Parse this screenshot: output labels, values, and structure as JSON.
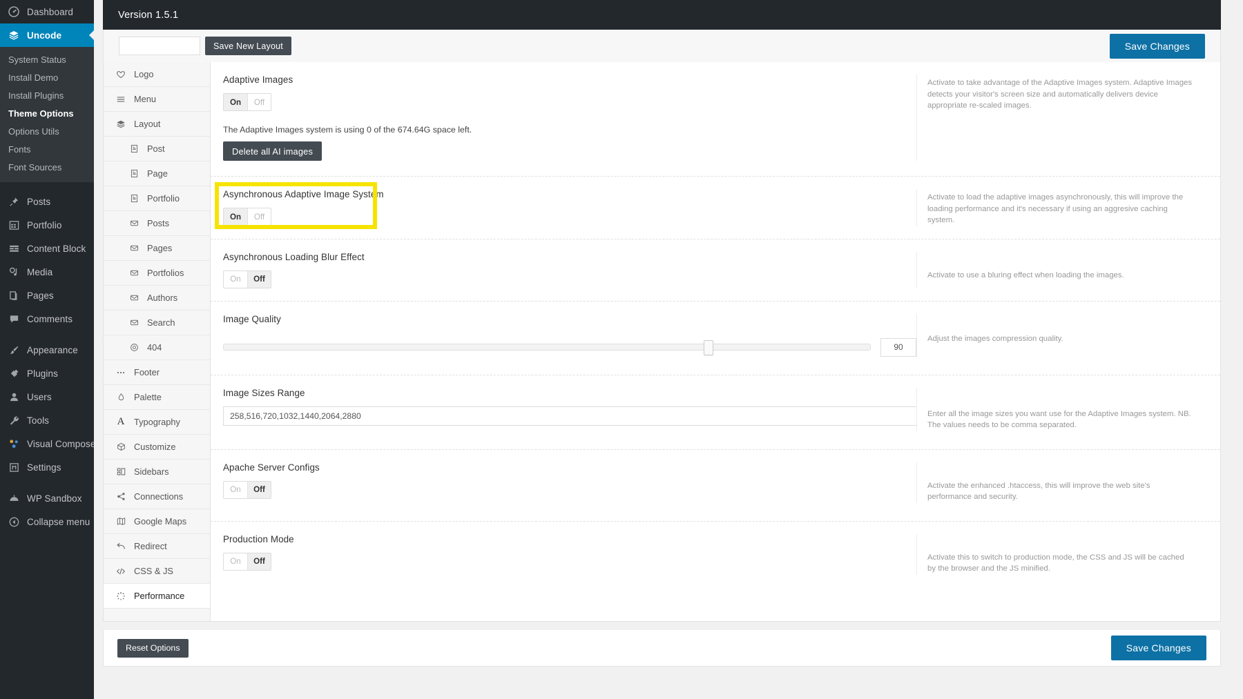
{
  "admin_menu": {
    "items": [
      {
        "label": "Dashboard",
        "icon": "dashboard-icon",
        "current": false
      },
      {
        "label": "Uncode",
        "icon": "layers-icon",
        "current": true
      }
    ],
    "submenu": [
      {
        "label": "System Status",
        "current": false
      },
      {
        "label": "Install Demo",
        "current": false
      },
      {
        "label": "Install Plugins",
        "current": false
      },
      {
        "label": "Theme Options",
        "current": true
      },
      {
        "label": "Options Utils",
        "current": false
      },
      {
        "label": "Fonts",
        "current": false
      },
      {
        "label": "Font Sources",
        "current": false
      }
    ],
    "group_two": [
      {
        "label": "Posts",
        "icon": "pin-icon"
      },
      {
        "label": "Portfolio",
        "icon": "grid-icon"
      },
      {
        "label": "Content Block",
        "icon": "blocks-icon"
      },
      {
        "label": "Media",
        "icon": "media-icon"
      },
      {
        "label": "Pages",
        "icon": "pages-icon"
      },
      {
        "label": "Comments",
        "icon": "comment-icon"
      }
    ],
    "group_three": [
      {
        "label": "Appearance",
        "icon": "brush-icon"
      },
      {
        "label": "Plugins",
        "icon": "plug-icon"
      },
      {
        "label": "Users",
        "icon": "user-icon"
      },
      {
        "label": "Tools",
        "icon": "wrench-icon"
      },
      {
        "label": "Visual Composer",
        "icon": "vc-icon"
      },
      {
        "label": "Settings",
        "icon": "settings-icon"
      }
    ],
    "group_four": [
      {
        "label": "WP Sandbox",
        "icon": "sandbox-icon"
      },
      {
        "label": "Collapse menu",
        "icon": "collapse-icon"
      }
    ]
  },
  "header": {
    "version": "Version 1.5.1",
    "layout_name_value": "",
    "layout_name_placeholder": "",
    "save_new_layout": "Save New Layout",
    "save_changes": "Save Changes"
  },
  "tabs": [
    {
      "label": "Logo",
      "icon": "heart-icon",
      "sub": false,
      "active": false
    },
    {
      "label": "Menu",
      "icon": "menu-icon",
      "sub": false,
      "active": false
    },
    {
      "label": "Layout",
      "icon": "layers-icon",
      "sub": false,
      "active": false
    },
    {
      "label": "Post",
      "icon": "document-icon",
      "sub": true,
      "active": false
    },
    {
      "label": "Page",
      "icon": "document-icon",
      "sub": true,
      "active": false
    },
    {
      "label": "Portfolio",
      "icon": "document-icon",
      "sub": true,
      "active": false
    },
    {
      "label": "Posts",
      "icon": "envelope-icon",
      "sub": true,
      "active": false
    },
    {
      "label": "Pages",
      "icon": "envelope-icon",
      "sub": true,
      "active": false
    },
    {
      "label": "Portfolios",
      "icon": "envelope-icon",
      "sub": true,
      "active": false
    },
    {
      "label": "Authors",
      "icon": "envelope-icon",
      "sub": true,
      "active": false
    },
    {
      "label": "Search",
      "icon": "envelope-icon",
      "sub": true,
      "active": false
    },
    {
      "label": "404",
      "icon": "target-icon",
      "sub": true,
      "active": false
    },
    {
      "label": "Footer",
      "icon": "dots-icon",
      "sub": false,
      "active": false
    },
    {
      "label": "Palette",
      "icon": "droplet-icon",
      "sub": false,
      "active": false
    },
    {
      "label": "Typography",
      "icon": "typography-icon",
      "sub": false,
      "active": false
    },
    {
      "label": "Customize",
      "icon": "cube-icon",
      "sub": false,
      "active": false
    },
    {
      "label": "Sidebars",
      "icon": "sidebars-icon",
      "sub": false,
      "active": false
    },
    {
      "label": "Connections",
      "icon": "share-icon",
      "sub": false,
      "active": false
    },
    {
      "label": "Google Maps",
      "icon": "map-icon",
      "sub": false,
      "active": false
    },
    {
      "label": "Redirect",
      "icon": "arrow-back-icon",
      "sub": false,
      "active": false
    },
    {
      "label": "CSS & JS",
      "icon": "code-icon",
      "sub": false,
      "active": false
    },
    {
      "label": "Performance",
      "icon": "spinner-icon",
      "sub": false,
      "active": true
    }
  ],
  "fields": {
    "adaptive_images": {
      "title": "Adaptive Images",
      "toggle_on": "On",
      "toggle_off": "Off",
      "selected": "On",
      "note": "The Adaptive Images system is using 0 of the 674.64G space left.",
      "delete_button": "Delete all AI images",
      "description": "Activate to take advantage of the Adaptive Images system. Adaptive Images detects your visitor's screen size and automatically delivers device appropriate re-scaled images."
    },
    "async_adaptive": {
      "title": "Asynchronous Adaptive Image System",
      "toggle_on": "On",
      "toggle_off": "Off",
      "selected": "On",
      "description": "Activate to load the adaptive images asynchronously, this will improve the loading performance and it's necessary if using an aggresive caching system."
    },
    "blur_effect": {
      "title": "Asynchronous Loading Blur Effect",
      "toggle_on": "On",
      "toggle_off": "Off",
      "selected": "Off",
      "description": "Activate to use a bluring effect when loading the images."
    },
    "image_quality": {
      "title": "Image Quality",
      "value": "90",
      "percent": 75,
      "description": "Adjust the images compression quality."
    },
    "image_sizes": {
      "title": "Image Sizes Range",
      "value": "258,516,720,1032,1440,2064,2880",
      "placeholder": "",
      "description": "Enter all the image sizes you want use for the Adaptive Images system. NB. The values needs to be comma separated."
    },
    "apache_configs": {
      "title": "Apache Server Configs",
      "toggle_on": "On",
      "toggle_off": "Off",
      "selected": "Off",
      "description": "Activate the enhanced .htaccess, this will improve the web site's performance and security."
    },
    "production_mode": {
      "title": "Production Mode",
      "toggle_on": "On",
      "toggle_off": "Off",
      "selected": "Off",
      "description": "Activate this to switch to production mode, the CSS and JS will be cached by the browser and the JS minified."
    }
  },
  "footer": {
    "reset_options": "Reset Options",
    "save_changes": "Save Changes"
  },
  "colors": {
    "accent_blue": "#0085ba",
    "button_blue": "#0d71a5",
    "dark_bar": "#23282d",
    "highlight_yellow": "#f6e400"
  }
}
